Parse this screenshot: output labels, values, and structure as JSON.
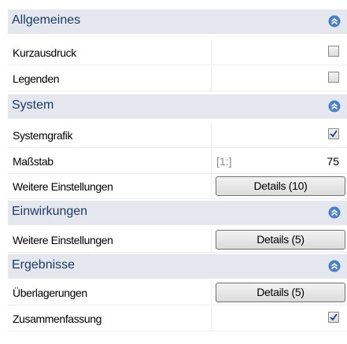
{
  "sections": {
    "allgemeines": {
      "title": "Allgemeines",
      "kurzausdruck_label": "Kurzausdruck",
      "legenden_label": "Legenden"
    },
    "system": {
      "title": "System",
      "systemgrafik_label": "Systemgrafik",
      "massstab_label": "Maßstab",
      "massstab_ratio": "[1:]",
      "massstab_value": "75",
      "weitere_label": "Weitere Einstellungen",
      "weitere_button": "Details (10)"
    },
    "einwirkungen": {
      "title": "Einwirkungen",
      "weitere_label": "Weitere Einstellungen",
      "weitere_button": "Details (5)"
    },
    "ergebnisse": {
      "title": "Ergebnisse",
      "ueberlagerungen_label": "Überlagerungen",
      "ueberlagerungen_button": "Details (5)",
      "zusammenfassung_label": "Zusammenfassung"
    }
  },
  "checkbox_states": {
    "kurzausdruck": false,
    "legenden": false,
    "systemgrafik": true,
    "zusammenfassung": true
  },
  "icons": {
    "collapse": "double-chevron-up-icon",
    "check": "checkmark-icon"
  },
  "colors": {
    "header_bg": "#e4e7ed",
    "header_text": "#1e3a66",
    "collapse_icon": "#4a7fc9"
  }
}
